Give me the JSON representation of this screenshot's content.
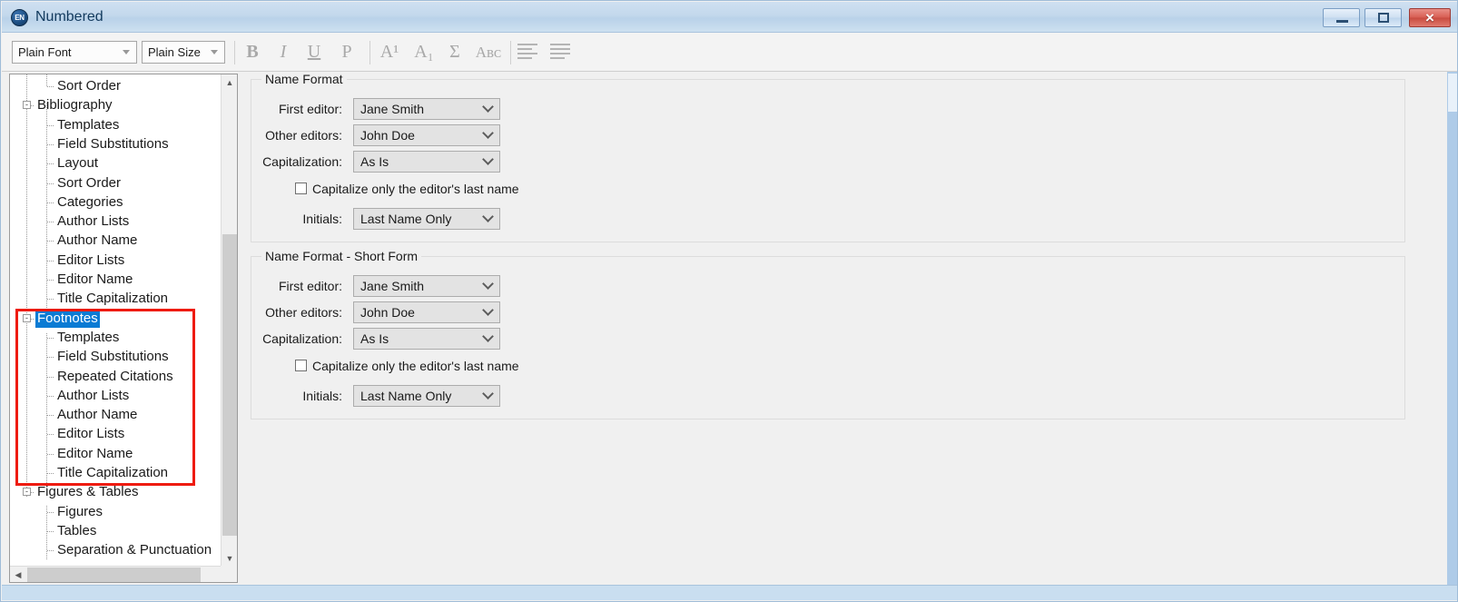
{
  "window": {
    "title": "Numbered",
    "app_icon": "EN",
    "controls": {
      "minimize": "minimize-button",
      "maximize": "restore-button",
      "close": "×"
    }
  },
  "toolbar": {
    "font_combo": "Plain Font",
    "size_combo": "Plain Size",
    "buttons": [
      {
        "name": "bold-button",
        "label": "B"
      },
      {
        "name": "italic-button",
        "label": "I"
      },
      {
        "name": "underline-button",
        "label": "U"
      },
      {
        "name": "plain-button",
        "label": "P"
      },
      {
        "name": "superscript-button",
        "label": "A¹"
      },
      {
        "name": "subscript-button",
        "label": "A₁"
      },
      {
        "name": "symbol-button",
        "label": "Σ"
      },
      {
        "name": "small-caps-button",
        "label": "Aʙᴄ"
      }
    ]
  },
  "tree": {
    "items": [
      {
        "label": "Sort Order",
        "depth": 2,
        "expander": "",
        "selected": false
      },
      {
        "label": "Bibliography",
        "depth": 1,
        "expander": "-",
        "selected": false
      },
      {
        "label": "Templates",
        "depth": 2,
        "expander": "",
        "selected": false
      },
      {
        "label": "Field Substitutions",
        "depth": 2,
        "expander": "",
        "selected": false
      },
      {
        "label": "Layout",
        "depth": 2,
        "expander": "",
        "selected": false
      },
      {
        "label": "Sort Order",
        "depth": 2,
        "expander": "",
        "selected": false
      },
      {
        "label": "Categories",
        "depth": 2,
        "expander": "",
        "selected": false
      },
      {
        "label": "Author Lists",
        "depth": 2,
        "expander": "",
        "selected": false
      },
      {
        "label": "Author Name",
        "depth": 2,
        "expander": "",
        "selected": false
      },
      {
        "label": "Editor Lists",
        "depth": 2,
        "expander": "",
        "selected": false
      },
      {
        "label": "Editor Name",
        "depth": 2,
        "expander": "",
        "selected": false
      },
      {
        "label": "Title Capitalization",
        "depth": 2,
        "expander": "",
        "selected": false
      },
      {
        "label": "Footnotes",
        "depth": 1,
        "expander": "-",
        "selected": true
      },
      {
        "label": "Templates",
        "depth": 2,
        "expander": "",
        "selected": false
      },
      {
        "label": "Field Substitutions",
        "depth": 2,
        "expander": "",
        "selected": false
      },
      {
        "label": "Repeated Citations",
        "depth": 2,
        "expander": "",
        "selected": false
      },
      {
        "label": "Author Lists",
        "depth": 2,
        "expander": "",
        "selected": false
      },
      {
        "label": "Author Name",
        "depth": 2,
        "expander": "",
        "selected": false
      },
      {
        "label": "Editor Lists",
        "depth": 2,
        "expander": "",
        "selected": false
      },
      {
        "label": "Editor Name",
        "depth": 2,
        "expander": "",
        "selected": false
      },
      {
        "label": "Title Capitalization",
        "depth": 2,
        "expander": "",
        "selected": false
      },
      {
        "label": "Figures & Tables",
        "depth": 1,
        "expander": "-",
        "selected": false
      },
      {
        "label": "Figures",
        "depth": 2,
        "expander": "",
        "selected": false
      },
      {
        "label": "Tables",
        "depth": 2,
        "expander": "",
        "selected": false
      },
      {
        "label": "Separation & Punctuation",
        "depth": 2,
        "expander": "",
        "selected": false
      }
    ],
    "highlight_color": "#ee1b11",
    "selection_color": "#0a7bd4"
  },
  "panel": {
    "groups": [
      {
        "title": "Name Format",
        "fields": [
          {
            "label": "First editor:",
            "value": "Jane Smith"
          },
          {
            "label": "Other editors:",
            "value": "John Doe"
          },
          {
            "label": "Capitalization:",
            "value": "As Is"
          }
        ],
        "checkbox": {
          "label": "Capitalize only the editor's last name",
          "checked": false
        },
        "initials": {
          "label": "Initials:",
          "value": "Last Name Only"
        }
      },
      {
        "title": "Name Format - Short Form",
        "fields": [
          {
            "label": "First editor:",
            "value": "Jane Smith"
          },
          {
            "label": "Other editors:",
            "value": "John Doe"
          },
          {
            "label": "Capitalization:",
            "value": "As Is"
          }
        ],
        "checkbox": {
          "label": "Capitalize only the editor's last name",
          "checked": false
        },
        "initials": {
          "label": "Initials:",
          "value": "Last Name Only"
        }
      }
    ]
  }
}
